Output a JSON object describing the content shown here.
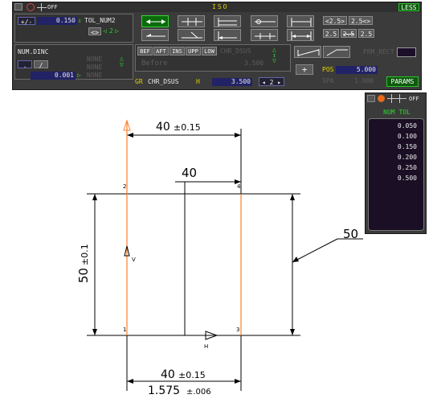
{
  "toolbar": {
    "title": "ISO",
    "less_label": "LESS",
    "off_label": "OFF",
    "plusminus_label": "+/-",
    "tol_value": "0.150",
    "tol_name": "TOL_NUM2",
    "tol_nav": "2",
    "num_dinc_label": "NUM.DINC",
    "decimal_value": "0.001",
    "none_labels": [
      "NONE",
      "NONE",
      "NONE"
    ],
    "position_buttons": [
      "BEF",
      "AFT",
      "INS",
      "UPP",
      "LOW"
    ],
    "chr_dsus_dim": "CHR_DSUS",
    "before_label": "Before",
    "before_value": "3.500",
    "frm_rect_label": "FRM_RECT",
    "gr_label": "GR",
    "chr_dsus_label": "CHR_DSUS",
    "h_label": "H",
    "h_value": "3.500",
    "page_nav": "2",
    "pos_label": "POS",
    "pos_value": "5.000",
    "spa_label": "SPA",
    "spa_value": "1.000",
    "params_label": "PARAMS",
    "num_format_buttons": [
      "<2.5>",
      "2.5<>",
      "2.5",
      "2.5",
      "2.5"
    ]
  },
  "tol_panel": {
    "off_label": "OFF",
    "header": "NUM TOL",
    "values": [
      "0.050",
      "0.100",
      "0.150",
      "0.200",
      "0.250",
      "0.500"
    ]
  },
  "drawing": {
    "top_dim": "40",
    "top_tol": "±0.15",
    "inner_dim": "40",
    "left_dim": "50",
    "left_tol": "±0.1",
    "right_leader_dim": "50",
    "bottom_dim": "40",
    "bottom_tol": "±0.15",
    "bottom_secondary": "1.575",
    "bottom_secondary_tol": "±.006",
    "corner_labels": [
      "1",
      "2",
      "3",
      "4"
    ],
    "v_label": "V",
    "h_label": "H",
    "orange_color": "#ff7f27"
  }
}
